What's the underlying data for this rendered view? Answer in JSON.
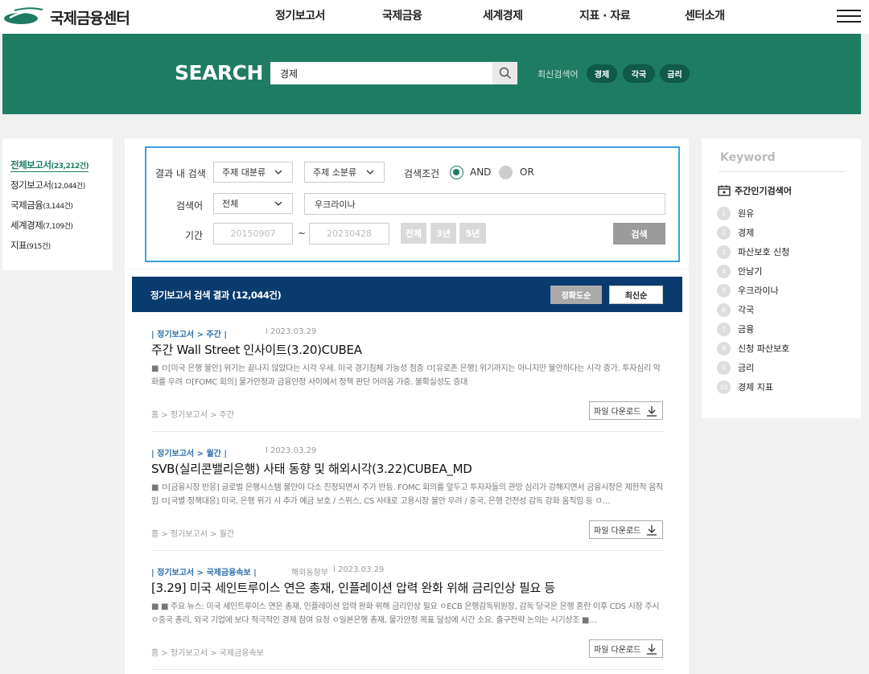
{
  "header": {
    "logo_text": "국제금융센터",
    "nav": [
      "정기보고서",
      "국제금융",
      "세계경제",
      "지표 · 자료",
      "센터소개"
    ]
  },
  "banner": {
    "title": "SEARCH",
    "query": "경제",
    "recent_label": "최신검색어",
    "recent_terms": [
      "경제",
      "각국",
      "금리"
    ]
  },
  "left_nav": [
    {
      "label": "전체보고서",
      "count": "(23,212건)"
    },
    {
      "label": "정기보고서",
      "count": "(12,044건)"
    },
    {
      "label": "국제금융",
      "count": "(3,144건)"
    },
    {
      "label": "세계경제",
      "count": "(7,109건)"
    },
    {
      "label": "지표",
      "count": "(915건)"
    }
  ],
  "filter": {
    "within_label": "결과 내 검색",
    "category_major": "주제 대분류",
    "category_minor": "주제 소분류",
    "condition_label": "검색조건",
    "and_label": "AND",
    "or_label": "OR",
    "keyword_label": "검색어",
    "keyword_scope": "전체",
    "keyword_value": "우크라이나",
    "period_label": "기간",
    "date_from": "20150907",
    "tilde": "~",
    "date_to": "20230428",
    "period_all": "전체",
    "period_3y": "3년",
    "period_5y": "5년",
    "search_button": "검색"
  },
  "results": {
    "heading": "정기보고서 검색 결과 (12,044건)",
    "sort_accuracy": "정확도순",
    "sort_latest": "최신순",
    "items": [
      {
        "category": "| 정기보고서 > 주간 |",
        "dept": "",
        "date": "l  2023.03.29",
        "title": "주간 Wall Street 인사이트(3.20)CUBEA",
        "desc": "■ ㅁ[미국 은행 불안] 위기는 끝나지 않았다는 시각 우세. 미국 경기침체 가능성 점증 ㅁ[유로존 은행] 위기까지는 아니지만 불안하다는 시각 증가. 투자심리 악화를 우려 ㅁ[FOMC 회의] 물가안정과 금융안정 사이에서 정책 판단 어려움 가중. 불확실성도 증대",
        "path": "홈  >  정기보고서  >  주간",
        "download": "파일 다운로드"
      },
      {
        "category": "| 정기보고서 > 월간 |",
        "dept": "",
        "date": "l  2023.03.29",
        "title": "SVB(실리콘밸리은행) 사태 동향 및 해외시각(3.22)CUBEA_MD",
        "desc": "■ ㅁ[금융시장 반응] 글로벌 은행시스템 불안이 다소 진정되면서 주가 반등. FOMC 회의를 앞두고 투자자들의 관망 심리가 강해지면서 금융시장은 제한적 움직임 ㅁ[국별 정책대응] 미국, 은행 위기 시 추가 예금 보호 / 스위스, CS 사태로 고용시장 불안 우려 / 중국, 은행 건전성 감독 강화 움직임 등 ㅁ…",
        "path": "홈  >  정기보고서  >  월간",
        "download": "파일 다운로드"
      },
      {
        "category": "| 정기보고서 > 국제금융속보 |",
        "dept": "해외동향부",
        "date": "l  2023.03.29",
        "title": "[3.29] 미국 세인트루이스 연은 총재, 인플레이션 압력 완화 위해 금리인상 필요 등",
        "desc": "■ ■ 주요 뉴스: 미국 세인트루이스 연은 총재, 인플레이션 압력 완화 위해 금리인상 필요 ㅇECB 은행감독위원장, 감독 당국은 은행 혼란 이후 CDS 시장 주시 ㅇ중국 총리, 외국 기업에 보다 적극적인 경제 참여 요청 ㅇ일본은행 총재, 물가안정 목표 달성에 시간 소요. 출구전략 논의는 시기상조 ■…",
        "path": "홈  >  정기보고서  >  국제금융속보",
        "download": "파일 다운로드"
      }
    ]
  },
  "keyword_panel": {
    "title": "Keyword",
    "heading": "주간인기검색어",
    "items": [
      "원유",
      "경제",
      "파산보호 신청",
      "안남기",
      "우크라이나",
      "각국",
      "금융",
      "신청 파산보호",
      "금리",
      "경제 지표"
    ]
  },
  "colors": {
    "brand_green": "#1e7c63",
    "navy": "#0a3b6e",
    "filter_border": "#3aa0e0"
  }
}
